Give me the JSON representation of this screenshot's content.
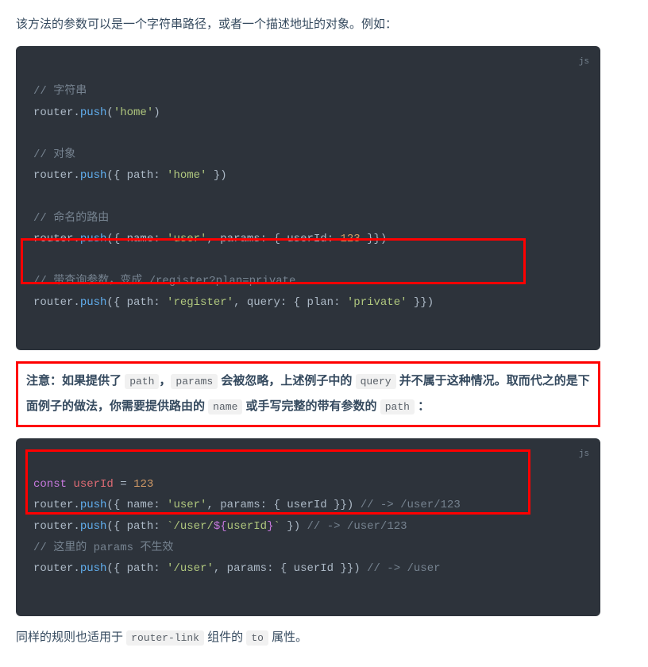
{
  "intro": "该方法的参数可以是一个字符串路径，或者一个描述地址的对象。例如：",
  "code1": {
    "lang": "js",
    "c_string": "// 字符串",
    "l_string": "router.push('home')",
    "c_object": "// 对象",
    "l_object": "router.push({ path: 'home' })",
    "c_named": "// 命名的路由",
    "l_named": "router.push({ name: 'user', params: { userId: 123 }})",
    "c_query": "// 带查询参数，变成 /register?plan=private",
    "l_query": "router.push({ path: 'register', query: { plan: 'private' }})"
  },
  "note": {
    "prefix": "注意：如果提供了",
    "path": "path",
    "mid1": "，",
    "params": "params",
    "mid2": " 会被忽略，上述例子中的 ",
    "query": "query",
    "mid3": " 并不属于这种情况。取而代之的是下面例子的做法，你需要提供路由的 ",
    "name": "name",
    "mid4": " 或手写完整的带有参数的 ",
    "path2": "path",
    "end": " ："
  },
  "code2": {
    "lang": "js",
    "l1": "const userId = 123",
    "l2": "router.push({ name: 'user', params: { userId }}) // -> /user/123",
    "l3": "router.push({ path: `/user/${userId}` }) // -> /user/123",
    "c4": "// 这里的 params 不生效",
    "l5": "router.push({ path: '/user', params: { userId }}) // -> /user"
  },
  "outro": {
    "pre": "同样的规则也适用于 ",
    "rl": "router-link",
    "mid": " 组件的 ",
    "to": "to",
    "end": " 属性。"
  }
}
